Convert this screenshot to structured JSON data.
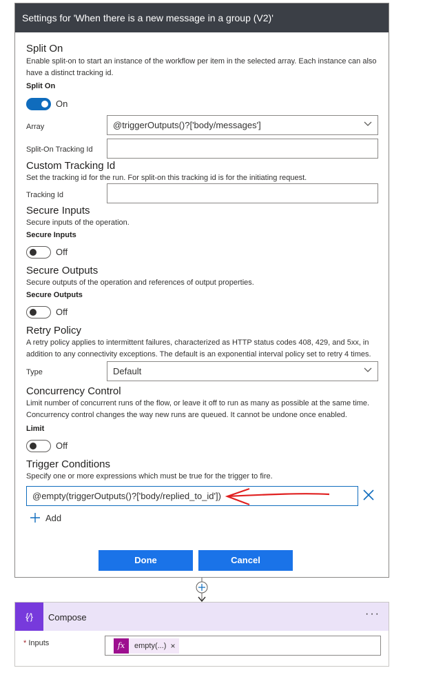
{
  "panel": {
    "title": "Settings for 'When there is a new message in a group (V2)'"
  },
  "split_on": {
    "title": "Split On",
    "desc": "Enable split-on to start an instance of the workflow per item in the selected array. Each instance can also have a distinct tracking id.",
    "toggle_label": "Split On",
    "toggle_state": "On",
    "array_label": "Array",
    "array_value": "@triggerOutputs()?['body/messages']",
    "tracking_label": "Split-On Tracking Id",
    "tracking_value": ""
  },
  "custom_tracking": {
    "title": "Custom Tracking Id",
    "desc": "Set the tracking id for the run. For split-on this tracking id is for the initiating request.",
    "label": "Tracking Id",
    "value": ""
  },
  "secure_inputs": {
    "title": "Secure Inputs",
    "desc": "Secure inputs of the operation.",
    "toggle_label": "Secure Inputs",
    "toggle_state": "Off"
  },
  "secure_outputs": {
    "title": "Secure Outputs",
    "desc": "Secure outputs of the operation and references of output properties.",
    "toggle_label": "Secure Outputs",
    "toggle_state": "Off"
  },
  "retry": {
    "title": "Retry Policy",
    "desc": "A retry policy applies to intermittent failures, characterized as HTTP status codes 408, 429, and 5xx, in addition to any connectivity exceptions. The default is an exponential interval policy set to retry 4 times.",
    "type_label": "Type",
    "type_value": "Default"
  },
  "concurrency": {
    "title": "Concurrency Control",
    "desc": "Limit number of concurrent runs of the flow, or leave it off to run as many as possible at the same time. Concurrency control changes the way new runs are queued. It cannot be undone once enabled.",
    "toggle_label": "Limit",
    "toggle_state": "Off"
  },
  "trigger_conditions": {
    "title": "Trigger Conditions",
    "desc": "Specify one or more expressions which must be true for the trigger to fire.",
    "condition_value": "@empty(triggerOutputs()?['body/replied_to_id'])",
    "add_label": "Add"
  },
  "buttons": {
    "done": "Done",
    "cancel": "Cancel"
  },
  "compose": {
    "icon_glyph": "{⁄}",
    "title": "Compose",
    "menu": "···",
    "inputs_required": "*",
    "inputs_label": "Inputs",
    "token_icon": "fx",
    "token_text": "empty(...)",
    "token_remove": "×"
  },
  "colors": {
    "header_bg": "#3b3f46",
    "toggle_on": "#0f6cbd",
    "button_primary": "#1a73e8",
    "compose_accent": "#773adc",
    "annotation_arrow": "#e02020"
  }
}
